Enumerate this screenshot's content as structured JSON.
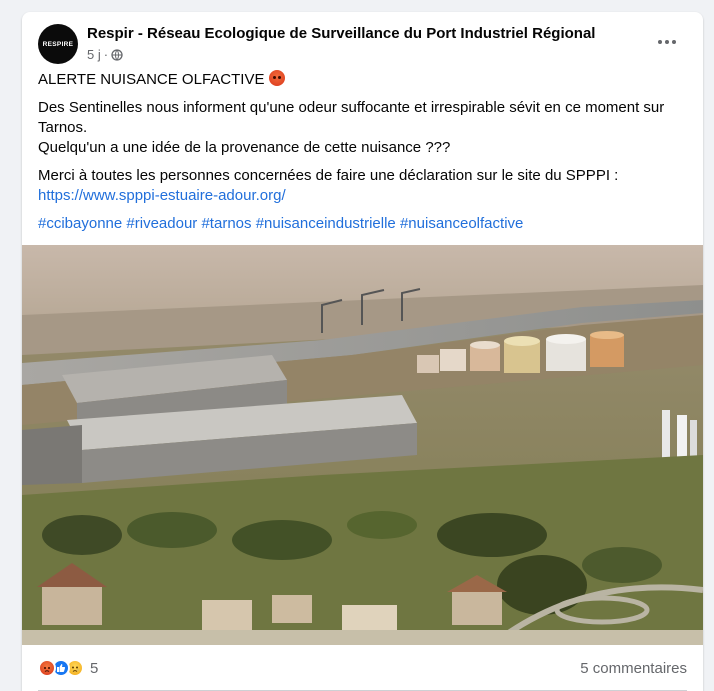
{
  "post": {
    "page_name": "Respir - Réseau Ecologique de Surveillance du Port Industriel Régional",
    "avatar_text": "RESPIRE",
    "timestamp": "5 j",
    "separator": "·",
    "privacy_icon": "globe-icon",
    "paragraphs": {
      "alert": "ALERTE NUISANCE OLFACTIVE",
      "line1": "Des Sentinelles nous informent qu'une odeur suffocante et irrespirable sévit en ce moment sur Tarnos.",
      "line2": "Quelqu'un a une idée de la provenance de cette nuisance ???",
      "line3_prefix": "Merci à toutes les personnes concernées de faire une déclaration sur le site du SPPPI : ",
      "link": "https://www.spppi-estuaire-adour.org/"
    },
    "hashtags": [
      "#ccibayonne",
      "#riveadour",
      "#tarnos",
      "#nuisanceindustrielle",
      "#nuisanceolfactive"
    ]
  },
  "photo": {
    "icon": "aerial-industrial-port-photo"
  },
  "footer": {
    "reaction_icons": [
      "angry-icon",
      "like-icon",
      "sad-icon"
    ],
    "reaction_count": "5",
    "comments_label": "5 commentaires"
  },
  "colors": {
    "link": "#216fdb",
    "secondary_text": "#65676b",
    "card_bg": "#ffffff",
    "page_bg": "#f0f2f5"
  }
}
